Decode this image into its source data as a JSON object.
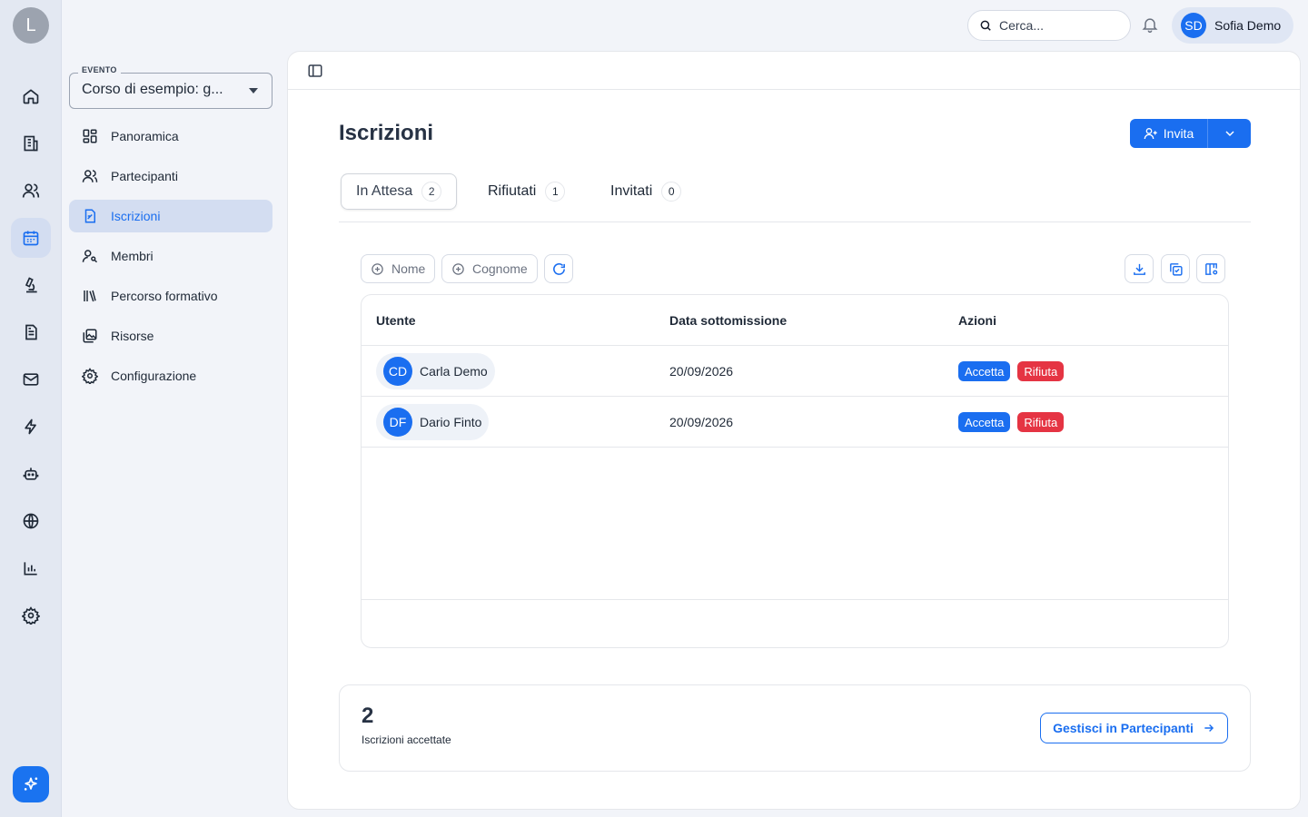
{
  "rail": {
    "avatar_initial": "L",
    "items": [
      "home-icon",
      "building-icon",
      "users-icon",
      "calendar-icon",
      "microscope-icon",
      "document-icon",
      "mail-icon",
      "lightning-icon",
      "robot-icon",
      "globe-icon",
      "chart-icon",
      "gear-icon"
    ],
    "active_item": "calendar-icon",
    "ai_button_icon": "sparkles-icon"
  },
  "topbar": {
    "search_placeholder": "Cerca...",
    "user_initials": "SD",
    "user_name": "Sofia Demo"
  },
  "event": {
    "legend": "EVENTO",
    "value": "Corso di esempio: g..."
  },
  "nav": {
    "items": [
      {
        "label": "Panoramica",
        "icon": "dashboard-icon"
      },
      {
        "label": "Partecipanti",
        "icon": "users-icon"
      },
      {
        "label": "Iscrizioni",
        "icon": "signup-file-icon",
        "active": true
      },
      {
        "label": "Membri",
        "icon": "member-key-icon"
      },
      {
        "label": "Percorso formativo",
        "icon": "library-icon"
      },
      {
        "label": "Risorse",
        "icon": "images-icon"
      },
      {
        "label": "Configurazione",
        "icon": "gear-icon"
      }
    ]
  },
  "main": {
    "title": "Iscrizioni",
    "invite_label": "Invita",
    "tabs": [
      {
        "label": "In Attesa",
        "count": "2",
        "active": true
      },
      {
        "label": "Rifiutati",
        "count": "1"
      },
      {
        "label": "Invitati",
        "count": "0"
      }
    ],
    "filters": [
      "Nome",
      "Cognome"
    ],
    "table": {
      "headers": [
        "Utente",
        "Data sottomissione",
        "Azioni"
      ],
      "rows": [
        {
          "initials": "CD",
          "name": "Carla Demo",
          "date": "20/09/2026",
          "accept": "Accetta",
          "reject": "Rifiuta"
        },
        {
          "initials": "DF",
          "name": "Dario Finto",
          "date": "20/09/2026",
          "accept": "Accetta",
          "reject": "Rifiuta"
        }
      ]
    },
    "summary": {
      "count": "2",
      "label": "Iscrizioni accettate",
      "button": "Gestisci in Partecipanti"
    }
  },
  "colors": {
    "accent": "#1a6ef0",
    "danger": "#e53443",
    "rail_bg": "#e3e8f2",
    "active_bg": "#d3ddf1"
  }
}
